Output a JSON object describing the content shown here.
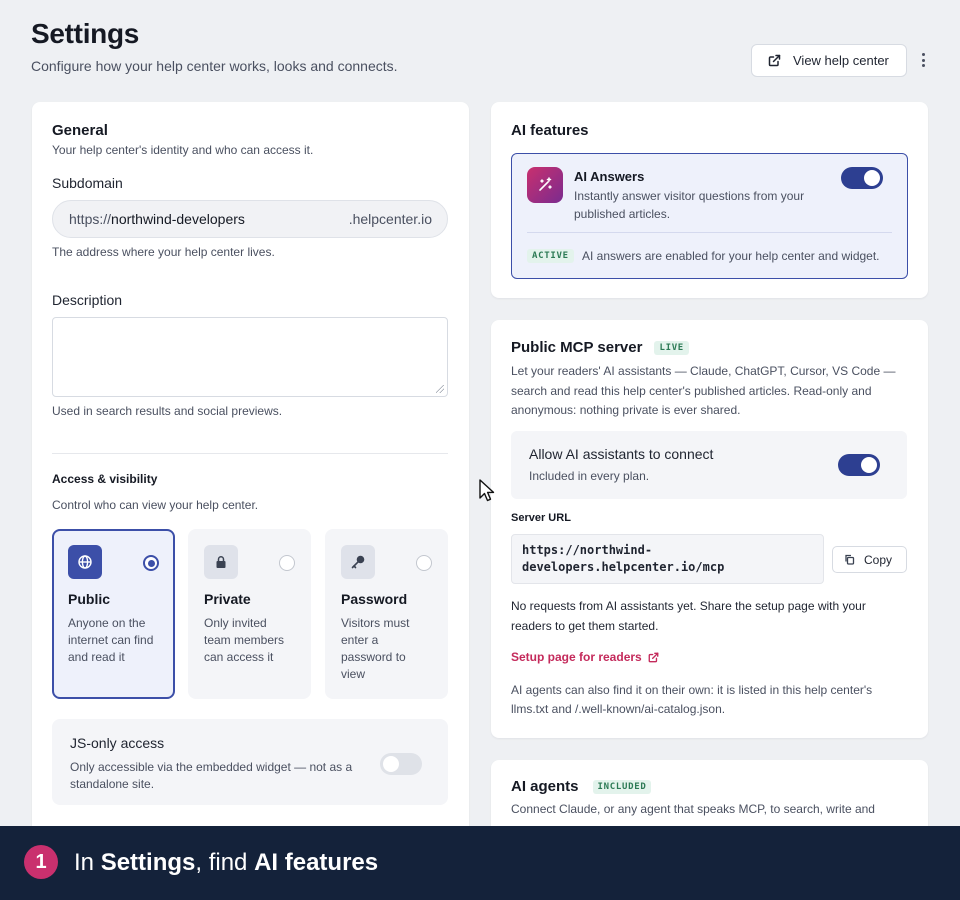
{
  "header": {
    "title": "Settings",
    "subtitle": "Configure how your help center works, looks and connects.",
    "view_button_label": "View help center"
  },
  "general": {
    "title": "General",
    "description": "Your help center's identity and who can access it.",
    "subdomain_label": "Subdomain",
    "subdomain_prefix": "https://",
    "subdomain_value": "northwind-developers",
    "subdomain_suffix": ".helpcenter.io",
    "subdomain_help": "The address where your help center lives.",
    "description_label": "Description",
    "description_value": "",
    "description_help": "Used in search results and social previews."
  },
  "access": {
    "title": "Access & visibility",
    "description": "Control who can view your help center.",
    "options": [
      {
        "title": "Public",
        "desc": "Anyone on the internet can find and read it",
        "icon": "globe-icon",
        "selected": true
      },
      {
        "title": "Private",
        "desc": "Only invited team members can access it",
        "icon": "lock-icon",
        "selected": false
      },
      {
        "title": "Password",
        "desc": "Visitors must enter a password to view",
        "icon": "key-icon",
        "selected": false
      }
    ],
    "js_only_title": "JS-only access",
    "js_only_desc": "Only accessible via the embedded widget — not as a standalone site.",
    "js_only_enabled": false
  },
  "ai_features": {
    "title": "AI features",
    "answers_title": "AI Answers",
    "answers_desc": "Instantly answer visitor questions from your published articles.",
    "answers_enabled": true,
    "status_badge": "ACTIVE",
    "status_text": "AI answers are enabled for your help center and widget."
  },
  "mcp": {
    "title": "Public MCP server",
    "badge": "LIVE",
    "description": "Let your readers' AI assistants — Claude, ChatGPT, Cursor, VS Code — search and read this help center's published articles. Read-only and anonymous: nothing private is ever shared.",
    "allow_title": "Allow AI assistants to connect",
    "allow_desc": "Included in every plan.",
    "allow_enabled": true,
    "server_url_label": "Server URL",
    "server_url": "https://northwind-developers.helpcenter.io/mcp",
    "copy_label": "Copy",
    "no_requests": "No requests from AI assistants yet. Share the setup page with your readers to get them started.",
    "setup_link": "Setup page for readers",
    "agents_note": "AI agents can also find it on their own: it is listed in this help center's llms.txt and /.well-known/ai-catalog.json."
  },
  "agents": {
    "title": "AI agents",
    "badge": "INCLUDED",
    "description": "Connect Claude, or any agent that speaks MCP, to search, write and"
  },
  "footer": {
    "step": "1",
    "text_in": "In ",
    "text_settings": "Settings",
    "text_find": ", find ",
    "text_target": "AI features"
  },
  "colors": {
    "accent": "#3c4fa8",
    "toggle_on": "#2d3f91",
    "link": "#c42a5b",
    "footer_bg": "#14223a",
    "step_badge": "#c9306e"
  }
}
